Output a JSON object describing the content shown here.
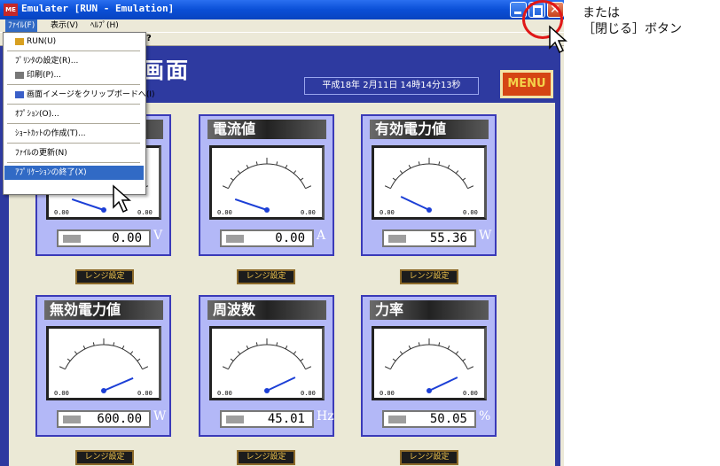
{
  "window": {
    "title": "Emulater [RUN - Emulation]",
    "app_icon_label": "ME"
  },
  "menubar": {
    "file": "ﾌｧｲﾙ(F)",
    "view": "表示(V)",
    "help": "ﾍﾙﾌﾟ(H)"
  },
  "toolbar": {
    "help_glyph": "?"
  },
  "dropdown": {
    "items": [
      "RUN(U)",
      "ﾌﾟﾘﾝﾀの設定(R)...",
      "印刷(P)...",
      "画面イメージをクリップボードへ(I)",
      "ｵﾌﾟｼｮﾝ(O)...",
      "ｼｮｰﾄｶｯﾄの作成(T)...",
      "ﾌｧｲﾙの更新(N)",
      "ｱﾌﾟﾘｹｰｼｮﾝの終了(X)"
    ],
    "selected_index": 7
  },
  "header": {
    "title": "画面",
    "datetime": "平成18年 2月11日 14時14分13秒",
    "menu_label": "MENU"
  },
  "meter_scale": {
    "min_label": "0.00",
    "max_label": "0.00"
  },
  "panels": [
    {
      "title": "",
      "value": "0.00",
      "unit": "V",
      "range_label": "レンジ設定",
      "needle_fraction": 0.05
    },
    {
      "title": "電流値",
      "value": "0.00",
      "unit": "A",
      "range_label": "レンジ設定",
      "needle_fraction": 0.05
    },
    {
      "title": "有効電力値",
      "value": "55.36",
      "unit": "W",
      "range_label": "レンジ設定",
      "needle_fraction": 0.12
    },
    {
      "title": "無効電力値",
      "value": "600.00",
      "unit": "W",
      "range_label": "レンジ設定",
      "needle_fraction": 0.9
    },
    {
      "title": "周波数",
      "value": "45.01",
      "unit": "Hz",
      "range_label": "レンジ設定",
      "needle_fraction": 0.88
    },
    {
      "title": "力率",
      "value": "50.05",
      "unit": "%",
      "range_label": "レンジ設定",
      "needle_fraction": 0.88
    }
  ],
  "annotation": {
    "line1": "または",
    "line2": "［閉じる］ボタン"
  },
  "colors": {
    "titlebar": "#0a4fd6",
    "client_bg": "#2e3aa0",
    "panel_bg": "#b3b8f7",
    "menu_button": "#d54514",
    "needle": "#1c3fd6",
    "annotation_circle": "#e01818"
  }
}
